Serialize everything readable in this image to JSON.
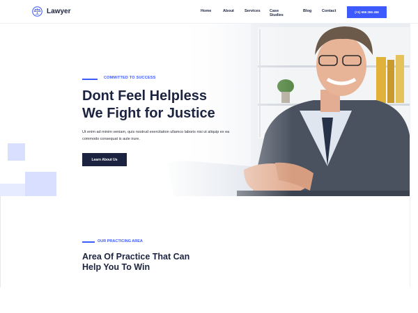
{
  "header": {
    "logo_text": "Lawyer",
    "nav": [
      "Home",
      "About",
      "Services",
      "Case Studies",
      "Blog",
      "Contact"
    ],
    "phone": "(+1) 656 266 456",
    "accent": "#3d5afe"
  },
  "hero": {
    "tagline": "COMMITTED TO SUCCESS",
    "headline_line1": "Dont Feel Helpless",
    "headline_line2": "We Fight for Justice",
    "description": "Ut enim ad minim veniam, quis nostrud exercitation ullamco laboris nisi ut aliquip ex ea commodo consequat is aute irure.",
    "button_label": "Learn About Us"
  },
  "practice": {
    "tagline": "OUR PRACTICING AREA",
    "title_line1": "Area Of Practice That Can",
    "title_line2": "Help You To Win"
  },
  "colors": {
    "navy": "#1b2340",
    "accent": "#3d5afe"
  }
}
